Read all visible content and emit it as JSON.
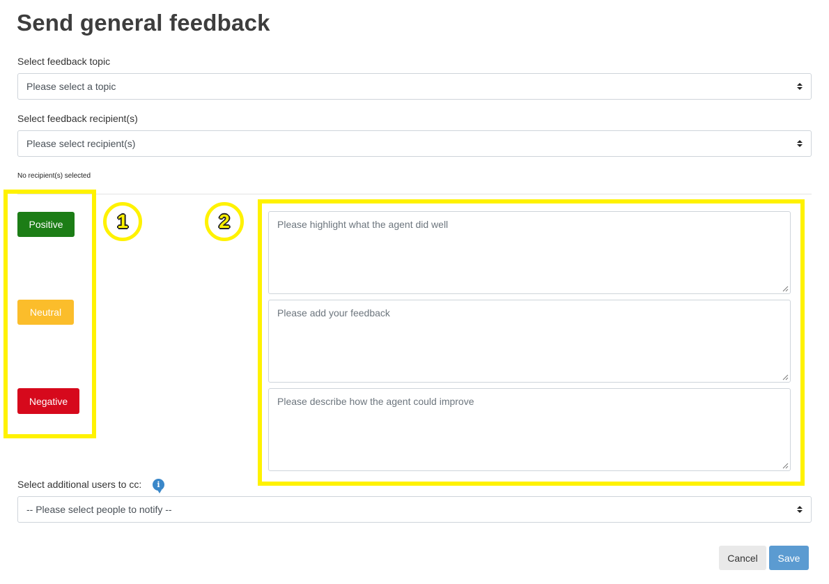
{
  "title": "Send general feedback",
  "topic": {
    "label": "Select feedback topic",
    "placeholder": "Please select a topic"
  },
  "recipients": {
    "label": "Select feedback recipient(s)",
    "placeholder": "Please select recipient(s)",
    "note": "No recipient(s) selected"
  },
  "sentiment": {
    "positive_label": "Positive",
    "positive_color": "#1c7d16",
    "neutral_label": "Neutral",
    "neutral_color": "#fbbd2b",
    "negative_label": "Negative",
    "negative_color": "#d6091c"
  },
  "annotations": {
    "marker_1": "1",
    "marker_2": "2",
    "highlight_color": "#fff200"
  },
  "textareas": {
    "well_placeholder": "Please highlight what the agent did well",
    "feedback_placeholder": "Please add your feedback",
    "improve_placeholder": "Please describe how the agent could improve"
  },
  "cc": {
    "label": "Select additional users to cc:",
    "info_icon": "info-icon",
    "placeholder": "-- Please select people to notify --"
  },
  "footer": {
    "cancel_label": "Cancel",
    "save_label": "Save",
    "save_color": "#5b9bd1"
  }
}
